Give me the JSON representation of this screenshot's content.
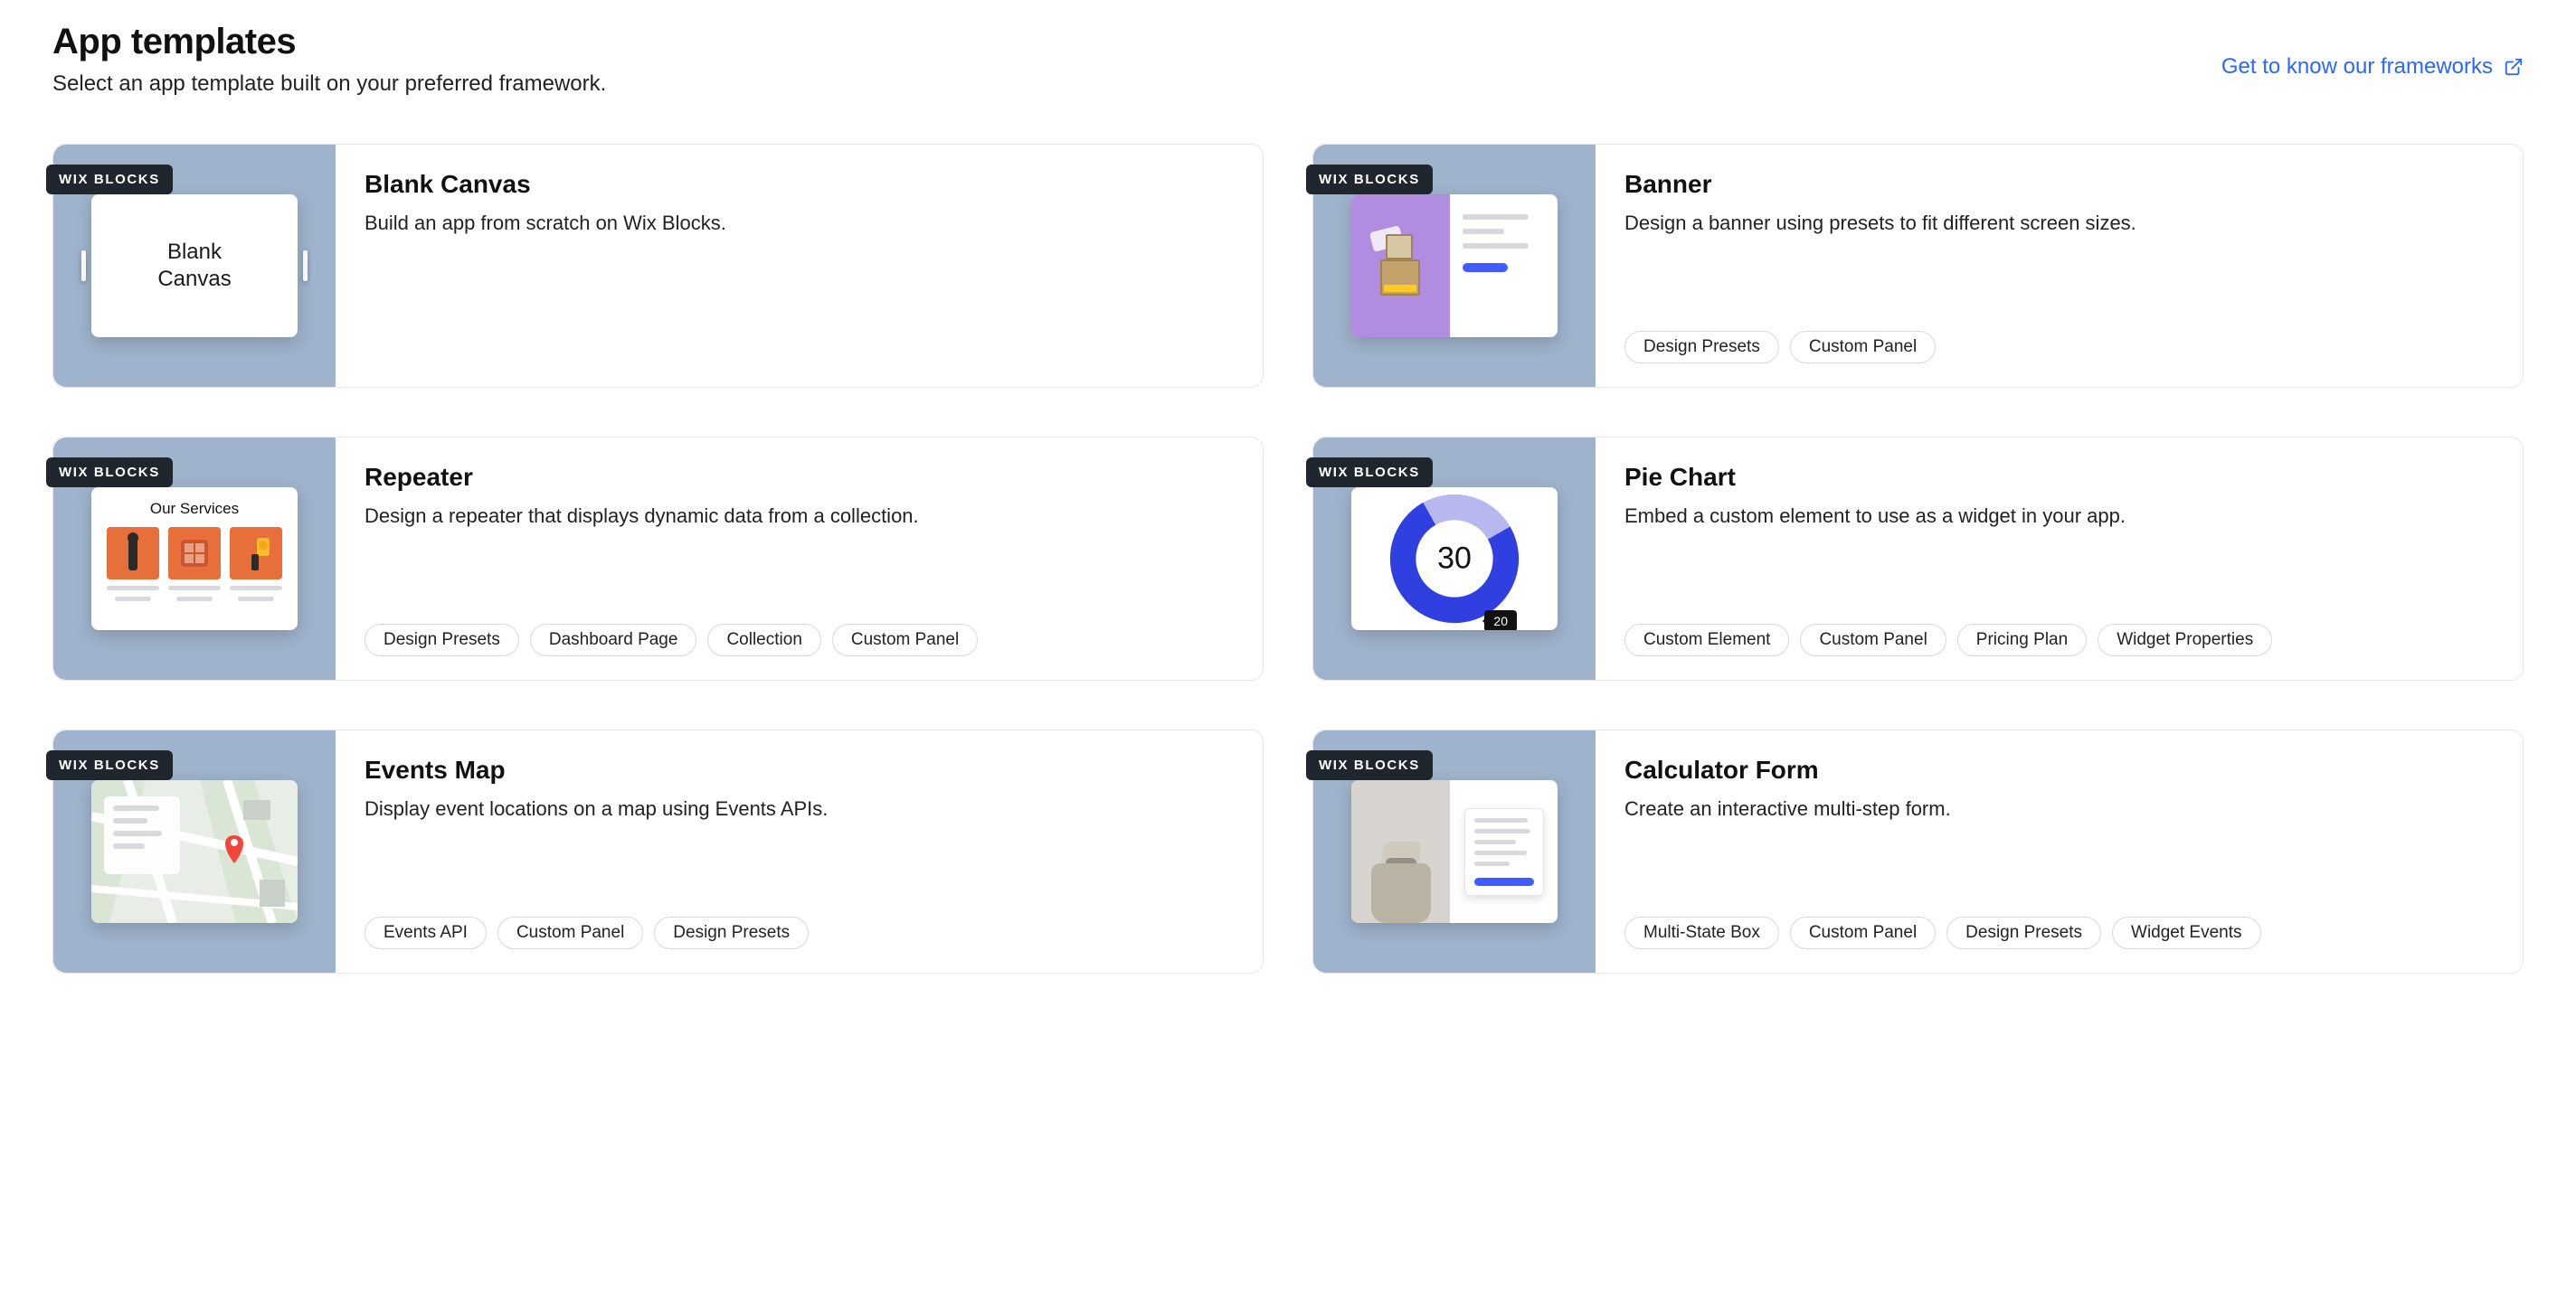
{
  "header": {
    "title": "App templates",
    "description": "Select an app template built on your preferred framework.",
    "frameworks_link": "Get to know our frameworks"
  },
  "badge_label": "WIX BLOCKS",
  "thumbs": {
    "blank_canvas_text": "Blank\nCanvas",
    "repeater_header": "Our Services",
    "pie_center": "30",
    "pie_tooltip": "20"
  },
  "cards": [
    {
      "id": "blank-canvas",
      "title": "Blank Canvas",
      "description": "Build an app from scratch on Wix Blocks.",
      "tags": []
    },
    {
      "id": "banner",
      "title": "Banner",
      "description": "Design a banner using presets to fit different screen sizes.",
      "tags": [
        "Design Presets",
        "Custom Panel"
      ]
    },
    {
      "id": "repeater",
      "title": "Repeater",
      "description": "Design a repeater that displays dynamic data from a collection.",
      "tags": [
        "Design Presets",
        "Dashboard Page",
        "Collection",
        "Custom Panel"
      ]
    },
    {
      "id": "pie-chart",
      "title": "Pie Chart",
      "description": "Embed a custom element to use as a widget in your app.",
      "tags": [
        "Custom Element",
        "Custom Panel",
        "Pricing Plan",
        "Widget Properties"
      ]
    },
    {
      "id": "events-map",
      "title": "Events Map",
      "description": "Display event locations on a map using Events APIs.",
      "tags": [
        "Events API",
        "Custom Panel",
        "Design Presets"
      ]
    },
    {
      "id": "calculator-form",
      "title": "Calculator Form",
      "description": "Create an interactive multi-step form.",
      "tags": [
        "Multi-State Box",
        "Custom Panel",
        "Design Presets",
        "Widget Events"
      ]
    }
  ]
}
